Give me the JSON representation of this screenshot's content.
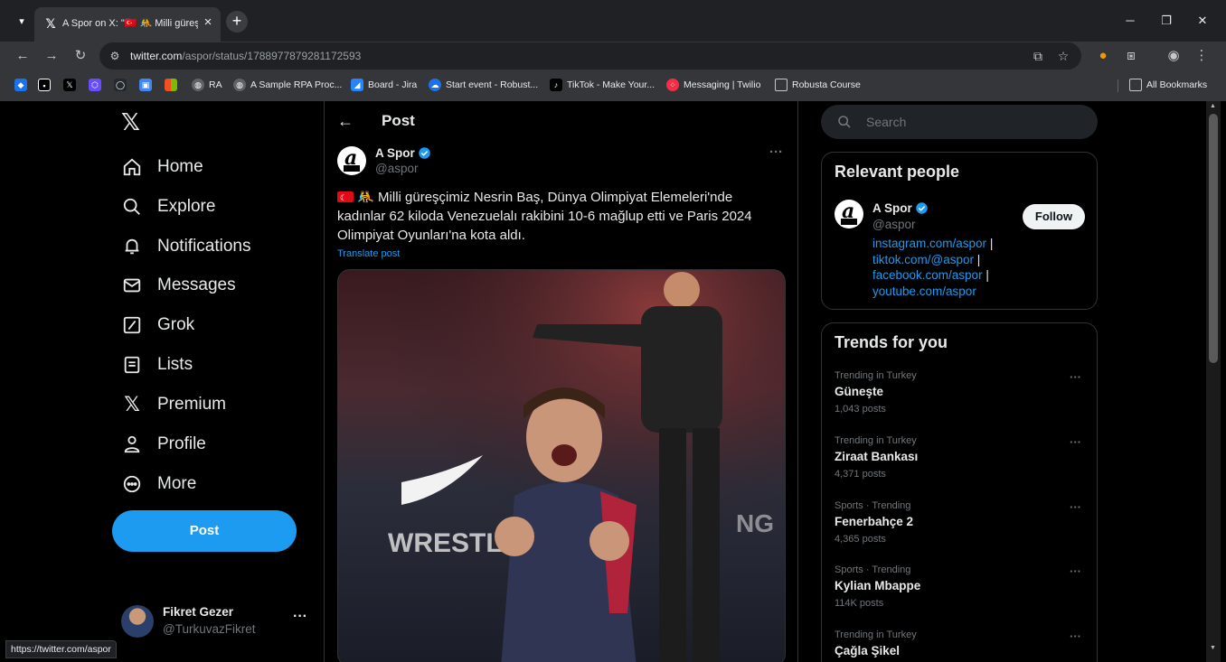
{
  "browser": {
    "tab_title": "A Spor on X: \"🇹🇷 🤼 Milli güreşç",
    "url_host": "twitter.com",
    "url_path": "/aspor/status/1788977879281172593",
    "bookmarks": [
      {
        "label": "RA",
        "color": "#5f6368"
      },
      {
        "label": "A Sample RPA Proc...",
        "color": "#5f6368"
      },
      {
        "label": "Board - Jira",
        "color": "#2684ff"
      },
      {
        "label": "Start event - Robust...",
        "color": "#1a73e8"
      },
      {
        "label": "TikTok - Make Your...",
        "color": "#000000"
      },
      {
        "label": "Messaging | Twilio",
        "color": "#f22f46"
      },
      {
        "label": "Robusta Course",
        "color": "#5f6368"
      }
    ],
    "all_bookmarks": "All Bookmarks",
    "status_url": "https://twitter.com/aspor"
  },
  "nav": {
    "items": [
      {
        "label": "Home",
        "icon": "home-icon"
      },
      {
        "label": "Explore",
        "icon": "search-icon"
      },
      {
        "label": "Notifications",
        "icon": "bell-icon"
      },
      {
        "label": "Messages",
        "icon": "mail-icon"
      },
      {
        "label": "Grok",
        "icon": "grok-icon"
      },
      {
        "label": "Lists",
        "icon": "list-icon"
      },
      {
        "label": "Premium",
        "icon": "x-icon"
      },
      {
        "label": "Profile",
        "icon": "person-icon"
      },
      {
        "label": "More",
        "icon": "more-circle-icon"
      }
    ],
    "post_button": "Post",
    "account_name": "Fikret Gezer",
    "account_handle": "@TurkuvazFikret"
  },
  "post": {
    "header": "Post",
    "author_name": "A Spor",
    "author_handle": "@aspor",
    "text": "Milli güreşçimiz Nesrin Baş, Dünya Olimpiyat Elemeleri'nde kadınlar 62 kiloda Venezuelalı rakibini 10-6 mağlup etti ve Paris 2024 Olimpiyat Oyunları'na kota aldı.",
    "translate": "Translate post"
  },
  "sidebar": {
    "search_placeholder": "Search",
    "relevant_title": "Relevant people",
    "relevant_name": "A Spor",
    "relevant_handle": "@aspor",
    "follow_label": "Follow",
    "links": [
      "instagram.com/aspor",
      "tiktok.com/@aspor",
      "facebook.com/aspor",
      "youtube.com/aspor"
    ],
    "trends_title": "Trends for you",
    "trends": [
      {
        "meta": "Trending in Turkey",
        "name": "Güneşte",
        "count": "1,043 posts"
      },
      {
        "meta": "Trending in Turkey",
        "name": "Ziraat Bankası",
        "count": "4,371 posts"
      },
      {
        "meta": "Sports · Trending",
        "name": "Fenerbahçe 2",
        "count": "4,365 posts"
      },
      {
        "meta": "Sports · Trending",
        "name": "Kylian Mbappe",
        "count": "114K posts"
      },
      {
        "meta": "Trending in Turkey",
        "name": "Çağla Şikel",
        "count": ""
      }
    ]
  }
}
